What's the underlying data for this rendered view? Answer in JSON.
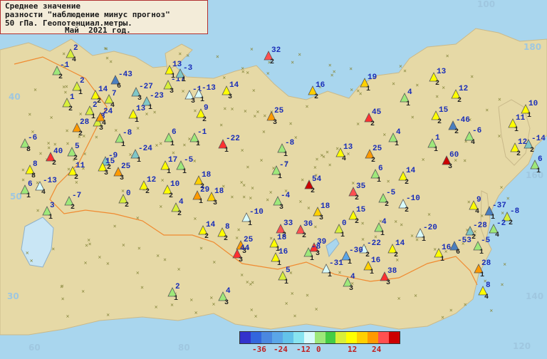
{
  "header": {
    "line1": "Среднее значение",
    "line2": "разности \"наблюдение минус прогноз\"",
    "line3": "50 гПа. Геопотенциал.метры.",
    "line4": "Май  2021 год."
  },
  "legend": {
    "colors": [
      "#3333cc",
      "#3366dd",
      "#4a88e0",
      "#5aa6e8",
      "#63c3ea",
      "#88e4f0",
      "#d8fbfb",
      "#9ee87a",
      "#44cc44",
      "#d8ef3a",
      "#ffff00",
      "#ffd000",
      "#ff9a00",
      "#ff5050",
      "#cc0000"
    ],
    "labels": [
      "-36",
      "-24",
      "-12",
      "0",
      "12",
      "24"
    ]
  },
  "grid_labels": [
    "180",
    "100",
    "160",
    "140",
    "120",
    "40",
    "50",
    "60",
    "80",
    "30"
  ],
  "stations": [
    {
      "v": "2",
      "c": "4",
      "color": "#d8ef3a"
    },
    {
      "v": "-1",
      "c": "2",
      "color": "#9ee87a"
    },
    {
      "v": "2",
      "c": "1",
      "color": "#d8ef3a"
    },
    {
      "v": "14",
      "c": "2",
      "color": "#ffff00"
    },
    {
      "v": "-43",
      "c": "6",
      "color": "#4a7fc0"
    },
    {
      "v": "-27",
      "c": "3",
      "color": "#7fc7c7"
    },
    {
      "v": "-17",
      "c": "3",
      "color": "#d8ef3a"
    },
    {
      "v": "13",
      "c": "1",
      "color": "#ffff00"
    },
    {
      "v": "-3",
      "c": "1",
      "color": "#7fc7c7"
    },
    {
      "v": "32",
      "c": "2",
      "color": "#ff5050"
    },
    {
      "v": "1",
      "c": "2",
      "color": "#d8ef3a"
    },
    {
      "v": "7",
      "c": "4",
      "color": "#d8ef3a"
    },
    {
      "v": "-23",
      "c": "1",
      "color": "#7fc7c7"
    },
    {
      "v": "-1",
      "c": "3",
      "color": "#d8fbfb"
    },
    {
      "v": "-13",
      "c": "1",
      "color": "#d8fbfb"
    },
    {
      "v": "14",
      "c": "3",
      "color": "#ffff00"
    },
    {
      "v": "16",
      "c": "2",
      "color": "#ffd000"
    },
    {
      "v": "19",
      "c": "1",
      "color": "#ffd000"
    },
    {
      "v": "13",
      "c": "2",
      "color": "#ffff00"
    },
    {
      "v": "4",
      "c": "1",
      "color": "#9ee87a"
    },
    {
      "v": "12",
      "c": "2",
      "color": "#ffff00"
    },
    {
      "v": "10",
      "c": "1",
      "color": "#ffff00"
    },
    {
      "v": "2",
      "c": "1",
      "color": "#d8ef3a"
    },
    {
      "v": "8",
      "c": "3",
      "color": "#d8ef3a"
    },
    {
      "v": "24",
      "c": "4",
      "color": "#ff9a00"
    },
    {
      "v": "13",
      "c": "1",
      "color": "#ffff00"
    },
    {
      "v": "9",
      "c": "2",
      "color": "#ffff00"
    },
    {
      "v": "25",
      "c": "3",
      "color": "#ff9a00"
    },
    {
      "v": "45",
      "c": "2",
      "color": "#ff3030"
    },
    {
      "v": "15",
      "c": "2",
      "color": "#ffff00"
    },
    {
      "v": "-46",
      "c": "2",
      "color": "#4a7fc0"
    },
    {
      "v": "11",
      "c": "1",
      "color": "#ffff00"
    },
    {
      "v": "28",
      "c": "2",
      "color": "#ff9a00"
    },
    {
      "v": "-8",
      "c": "1",
      "color": "#9ee87a"
    },
    {
      "v": "6",
      "c": "1",
      "color": "#9ee87a"
    },
    {
      "v": "-1",
      "c": "1",
      "color": "#9ee87a"
    },
    {
      "v": "4",
      "c": "1",
      "color": "#9ee87a"
    },
    {
      "v": "1",
      "c": "1",
      "color": "#9ee87a"
    },
    {
      "v": "-6",
      "c": "4",
      "color": "#9ee87a"
    },
    {
      "v": "-14",
      "c": "2",
      "color": "#7fc7c7"
    },
    {
      "v": "-6",
      "c": "8",
      "color": "#9ee87a"
    },
    {
      "v": "5",
      "c": "2",
      "color": "#9ee87a"
    },
    {
      "v": "40",
      "c": "2",
      "color": "#ff3030"
    },
    {
      "v": "-22",
      "c": "1",
      "color": "#ff3030"
    },
    {
      "v": "-8",
      "c": "1",
      "color": "#9ee87a"
    },
    {
      "v": "13",
      "c": "4",
      "color": "#ffff00"
    },
    {
      "v": "25",
      "c": "2",
      "color": "#ff9a00"
    },
    {
      "v": "12",
      "c": "2",
      "color": "#ffff00"
    },
    {
      "v": "60",
      "c": "3",
      "color": "#cc0000"
    },
    {
      "v": "6",
      "c": "1",
      "color": "#9ee87a"
    },
    {
      "v": "8",
      "c": "8",
      "color": "#ffff00"
    },
    {
      "v": "11",
      "c": "2",
      "color": "#ffff00"
    },
    {
      "v": "-9",
      "c": "2",
      "color": "#7fc7c7"
    },
    {
      "v": "15",
      "c": "3",
      "color": "#ffff00"
    },
    {
      "v": "25",
      "c": "3",
      "color": "#ff9a00"
    },
    {
      "v": "-24",
      "c": "1",
      "color": "#7fc7c7"
    },
    {
      "v": "17",
      "c": "1",
      "color": "#ffff00"
    },
    {
      "v": "-5",
      "c": "1",
      "color": "#9ee87a"
    },
    {
      "v": "6",
      "c": "1",
      "color": "#9ee87a"
    },
    {
      "v": "14",
      "c": "2",
      "color": "#ffff00"
    },
    {
      "v": "-7",
      "c": "1",
      "color": "#9ee87a"
    },
    {
      "v": "6",
      "c": "1",
      "color": "#9ee87a"
    },
    {
      "v": "-13",
      "c": "4",
      "color": "#d8fbfb"
    },
    {
      "v": "18",
      "c": "2",
      "color": "#ffd000"
    },
    {
      "v": "12",
      "c": "2",
      "color": "#ffff00"
    },
    {
      "v": "18",
      "c": "3",
      "color": "#ffd000"
    },
    {
      "v": "54",
      "c": "2",
      "color": "#cc0000"
    },
    {
      "v": "10",
      "c": "2",
      "color": "#ffff00"
    },
    {
      "v": "29",
      "c": "1",
      "color": "#ff9a00"
    },
    {
      "v": "0",
      "c": "2",
      "color": "#d8ef3a"
    },
    {
      "v": "-7",
      "c": "2",
      "color": "#9ee87a"
    },
    {
      "v": "-4",
      "c": "3",
      "color": "#9ee87a"
    },
    {
      "v": "35",
      "c": "2",
      "color": "#ff5050"
    },
    {
      "v": "-5",
      "c": "2",
      "color": "#9ee87a"
    },
    {
      "v": "-10",
      "c": "2",
      "color": "#d8fbfb"
    },
    {
      "v": "9",
      "c": "4",
      "color": "#ffff00"
    },
    {
      "v": "-37",
      "c": "1",
      "color": "#4a7fc0"
    },
    {
      "v": "3",
      "c": "1",
      "color": "#9ee87a"
    },
    {
      "v": "4",
      "c": "2",
      "color": "#d8ef3a"
    },
    {
      "v": "18",
      "c": "3",
      "color": "#ffd000"
    },
    {
      "v": "15",
      "c": "2",
      "color": "#ffff00"
    },
    {
      "v": "-8",
      "c": "2",
      "color": "#d8ef3a"
    },
    {
      "v": "-10",
      "c": "1",
      "color": "#d8fbfb"
    },
    {
      "v": "14",
      "c": "2",
      "color": "#ffff00"
    },
    {
      "v": "33",
      "c": "2",
      "color": "#ff5050"
    },
    {
      "v": "36",
      "c": "2",
      "color": "#ff5050"
    },
    {
      "v": "0",
      "c": "1",
      "color": "#d8ef3a"
    },
    {
      "v": "4",
      "c": "1",
      "color": "#9ee87a"
    },
    {
      "v": "-20",
      "c": "1",
      "color": "#d8fbfb"
    },
    {
      "v": "-28",
      "c": "2",
      "color": "#7fc7c7"
    },
    {
      "v": "-2",
      "c": "4",
      "color": "#9ee87a"
    },
    {
      "v": "8",
      "c": "2",
      "color": "#ffff00"
    },
    {
      "v": "25",
      "c": "3",
      "color": "#ff9a00"
    },
    {
      "v": "18",
      "c": "1",
      "color": "#ffff00"
    },
    {
      "v": "39",
      "c": "3",
      "color": "#ff3030"
    },
    {
      "v": "14",
      "c": "2",
      "color": "#ffff00"
    },
    {
      "v": "-22",
      "c": "2",
      "color": "#d8fbfb"
    },
    {
      "v": "-53",
      "c": "6",
      "color": "#4a7fc0"
    },
    {
      "v": "-5",
      "c": "1",
      "color": "#9ee87a"
    },
    {
      "v": "16",
      "c": "1",
      "color": "#ffff00"
    },
    {
      "v": "44",
      "c": "3",
      "color": "#ff3030"
    },
    {
      "v": "16",
      "c": "1",
      "color": "#ffff00"
    },
    {
      "v": "-8",
      "c": "1",
      "color": "#9ee87a"
    },
    {
      "v": "-30",
      "c": "1",
      "color": "#5aa6e8"
    },
    {
      "v": "16",
      "c": "1",
      "color": "#ffd000"
    },
    {
      "v": "28",
      "c": "1",
      "color": "#ff9a00"
    },
    {
      "v": "-31",
      "c": "1",
      "color": "#d8fbfb"
    },
    {
      "v": "5",
      "c": "1",
      "color": "#d8ef3a"
    },
    {
      "v": "4",
      "c": "3",
      "color": "#9ee87a"
    },
    {
      "v": "38",
      "c": "3",
      "color": "#ff3030"
    },
    {
      "v": "8",
      "c": "4",
      "color": "#ffff00"
    },
    {
      "v": "2",
      "c": "1",
      "color": "#9ee87a"
    },
    {
      "v": "4",
      "c": "3",
      "color": "#9ee87a"
    }
  ]
}
